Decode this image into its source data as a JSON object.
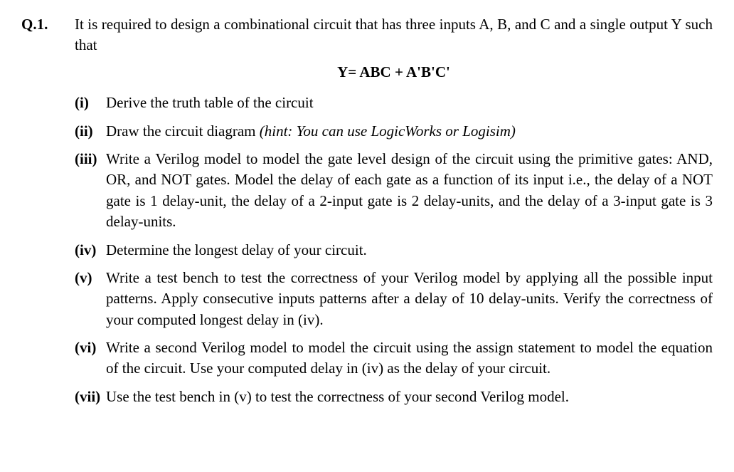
{
  "question": {
    "number": "Q.1.",
    "intro": "It is required to design a combinational circuit that has three inputs A, B, and C and a single output Y such that",
    "equation": "Y= ABC + A'B'C'",
    "parts": [
      {
        "marker": "(i)",
        "text": "Derive the truth table of the circuit",
        "hint": ""
      },
      {
        "marker": "(ii)",
        "text": "Draw the circuit diagram ",
        "hint": "(hint: You can use LogicWorks or Logisim)"
      },
      {
        "marker": "(iii)",
        "text": "Write a Verilog model to model the gate level design of the circuit using the primitive gates: AND, OR, and NOT gates. Model the delay of each gate as a function of its input i.e., the delay of a NOT gate is 1 delay-unit, the delay of a 2-input gate is 2 delay-units, and the delay of a 3-input gate is 3 delay-units.",
        "hint": ""
      },
      {
        "marker": "(iv)",
        "text": "Determine the longest delay of your circuit.",
        "hint": ""
      },
      {
        "marker": "(v)",
        "text": "Write a test bench to test the correctness of your Verilog model by applying all the possible input patterns. Apply consecutive inputs patterns after a delay of 10 delay-units. Verify the correctness of your computed longest delay in (iv).",
        "hint": ""
      },
      {
        "marker": "(vi)",
        "text": "Write a second Verilog model to model the circuit using the assign statement to model the equation of the circuit. Use your computed delay in (iv) as the delay of your circuit.",
        "hint": ""
      },
      {
        "marker": "(vii)",
        "text": "Use the test bench in (v) to test the correctness of your second Verilog model.",
        "hint": ""
      }
    ]
  }
}
